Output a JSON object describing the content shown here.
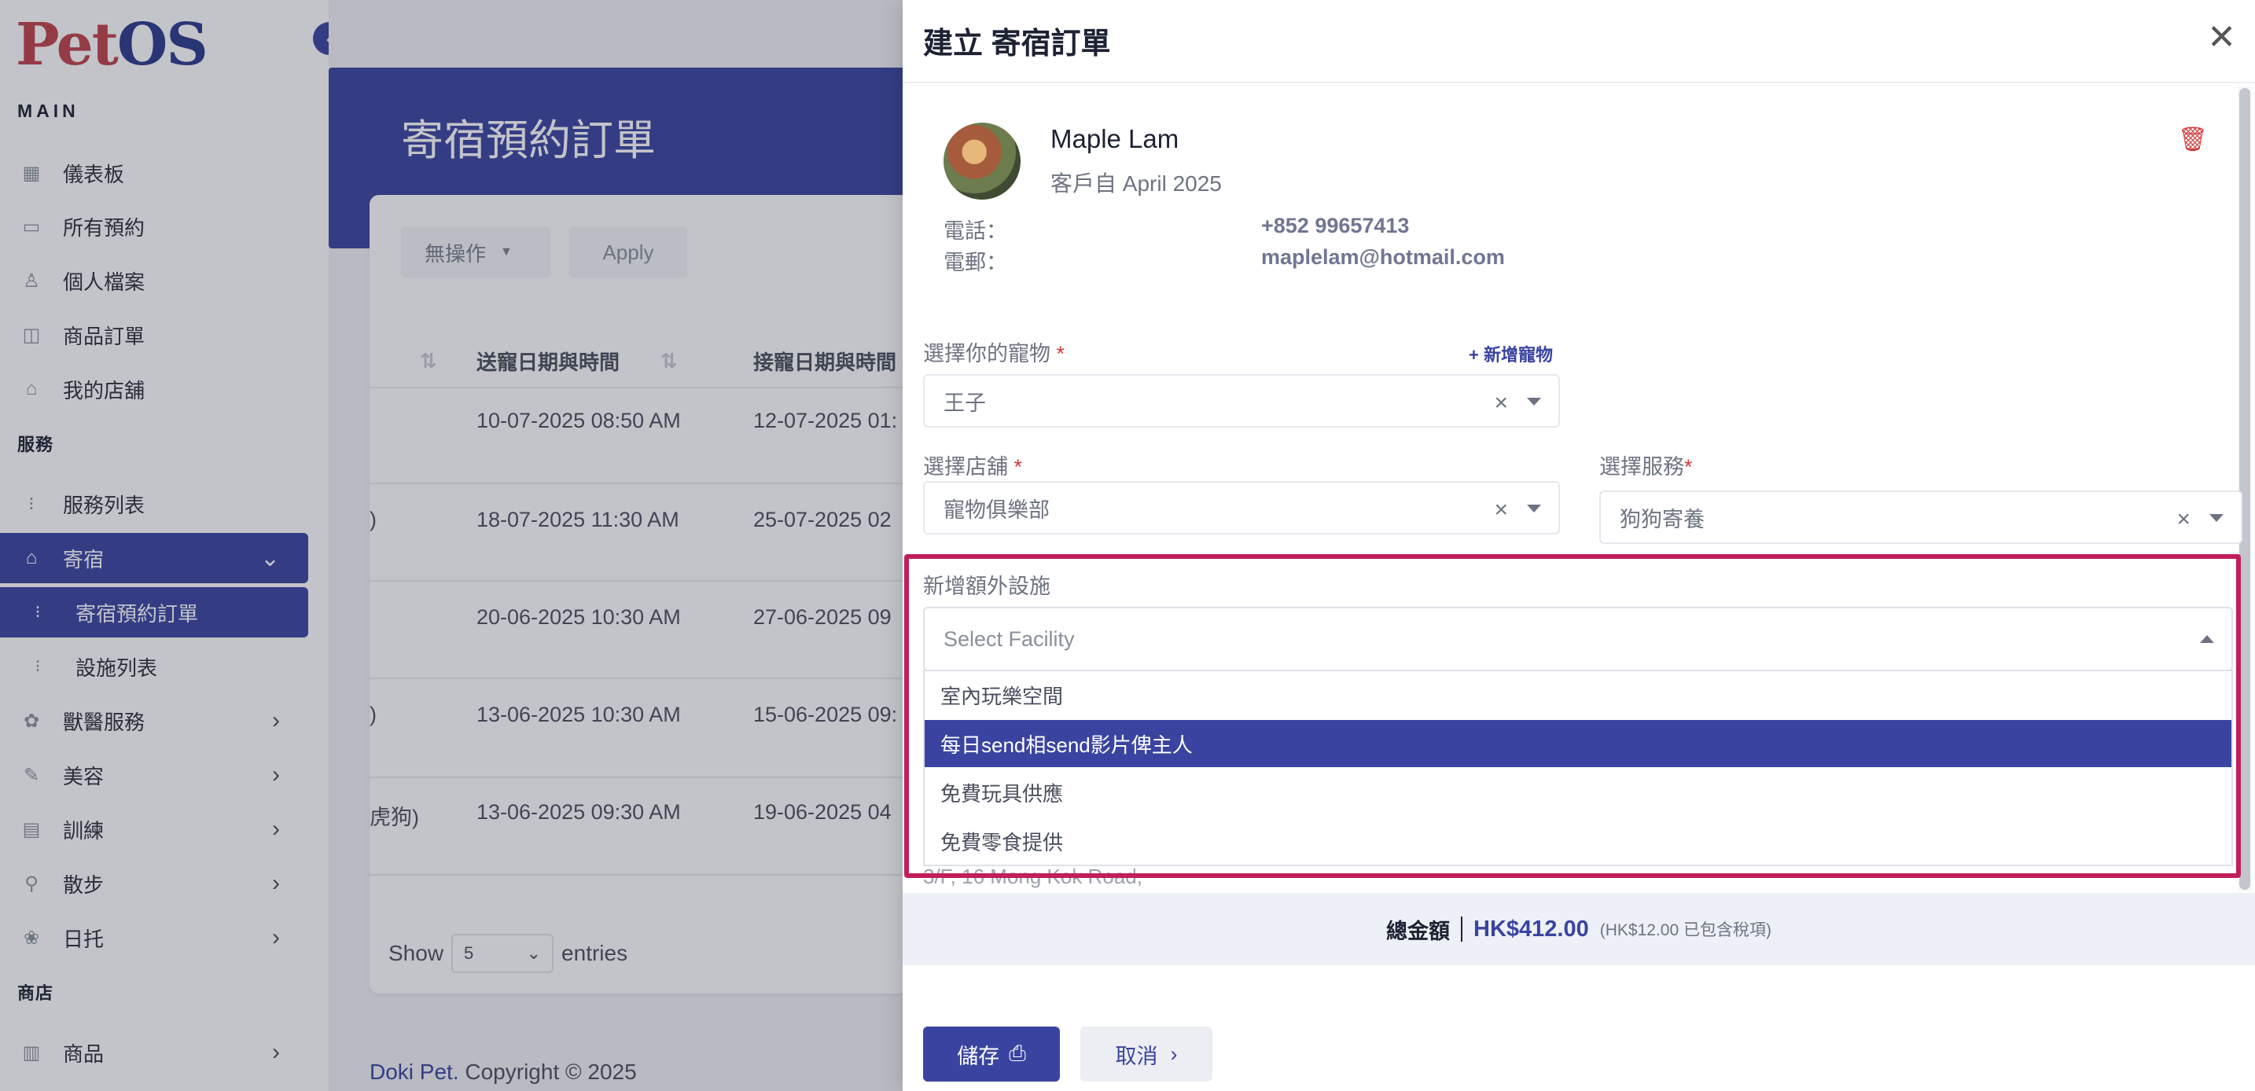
{
  "app": {
    "logo_pet": "Pet",
    "logo_os": "OS"
  },
  "sidebar": {
    "main_label": "MAIN",
    "services_label": "服務",
    "shop_label": "商店",
    "items": [
      {
        "label": "儀表板",
        "icon": "grid-icon"
      },
      {
        "label": "所有預約",
        "icon": "calendar-icon"
      },
      {
        "label": "個人檔案",
        "icon": "user-icon"
      },
      {
        "label": "商品訂單",
        "icon": "bag-icon"
      },
      {
        "label": "我的店舖",
        "icon": "store-icon"
      },
      {
        "label": "服務列表",
        "icon": "list-icon"
      },
      {
        "label": "寄宿",
        "icon": "home-icon"
      },
      {
        "label": "寄宿預約訂單",
        "icon": "list-icon"
      },
      {
        "label": "設施列表",
        "icon": "list-icon"
      },
      {
        "label": "獸醫服務",
        "icon": "vet-icon"
      },
      {
        "label": "美容",
        "icon": "brush-icon"
      },
      {
        "label": "訓練",
        "icon": "training-icon"
      },
      {
        "label": "散步",
        "icon": "walk-icon"
      },
      {
        "label": "日托",
        "icon": "daycare-icon"
      },
      {
        "label": "商品",
        "icon": "shop-icon"
      }
    ]
  },
  "page": {
    "title": "寄宿預約訂單",
    "bulk_action": "無操作",
    "apply": "Apply",
    "columns": [
      "送寵日期與時間",
      "接寵日期與時間"
    ],
    "rows": [
      {
        "prefix": "",
        "dropoff": "10-07-2025 08:50 AM",
        "pickup": "12-07-2025 01:"
      },
      {
        "prefix": ")",
        "dropoff": "18-07-2025 11:30 AM",
        "pickup": "25-07-2025 02"
      },
      {
        "prefix": "",
        "dropoff": "20-06-2025 10:30 AM",
        "pickup": "27-06-2025 09"
      },
      {
        "prefix": ")",
        "dropoff": "13-06-2025 10:30 AM",
        "pickup": "15-06-2025 09:"
      },
      {
        "prefix": "虎狗)",
        "dropoff": "13-06-2025 09:30 AM",
        "pickup": "19-06-2025 04"
      }
    ],
    "show_label": "Show",
    "show_value": "5",
    "entries_label": "entries",
    "footer_brand": "Doki Pet.",
    "footer_copy": " Copyright © 2025"
  },
  "modal": {
    "title": "建立 寄宿訂單",
    "customer_name": "Maple Lam",
    "customer_since": "客戶自 April 2025",
    "phone_label": "電話：",
    "phone_value": "+852 99657413",
    "email_label": "電郵：",
    "email_value": "maplelam@hotmail.com",
    "pet_label": "選擇你的寵物",
    "add_pet": "+ 新增寵物",
    "pet_value": "王子",
    "store_label": "選擇店舖",
    "store_value": "寵物俱樂部",
    "service_label": "選擇服務",
    "service_value": "狗狗寄養",
    "facility_label": "新增額外設施",
    "facility_placeholder": "Select Facility",
    "facility_options": [
      "室內玩樂空間",
      "每日send相send影片俾主人",
      "免費玩具供應",
      "免費零食提供"
    ],
    "selected_option_index": 1,
    "address_partial": "3/F, 16 Mong Kok Road,",
    "total_label": "總金額",
    "total_amount": "HK$412.00",
    "tax_note": "(HK$12.00 已包含稅項)",
    "save": "儲存",
    "cancel": "取消"
  },
  "colors": {
    "primary": "#3a44a0",
    "highlight": "#c21e5c",
    "danger": "#d23b3b"
  }
}
